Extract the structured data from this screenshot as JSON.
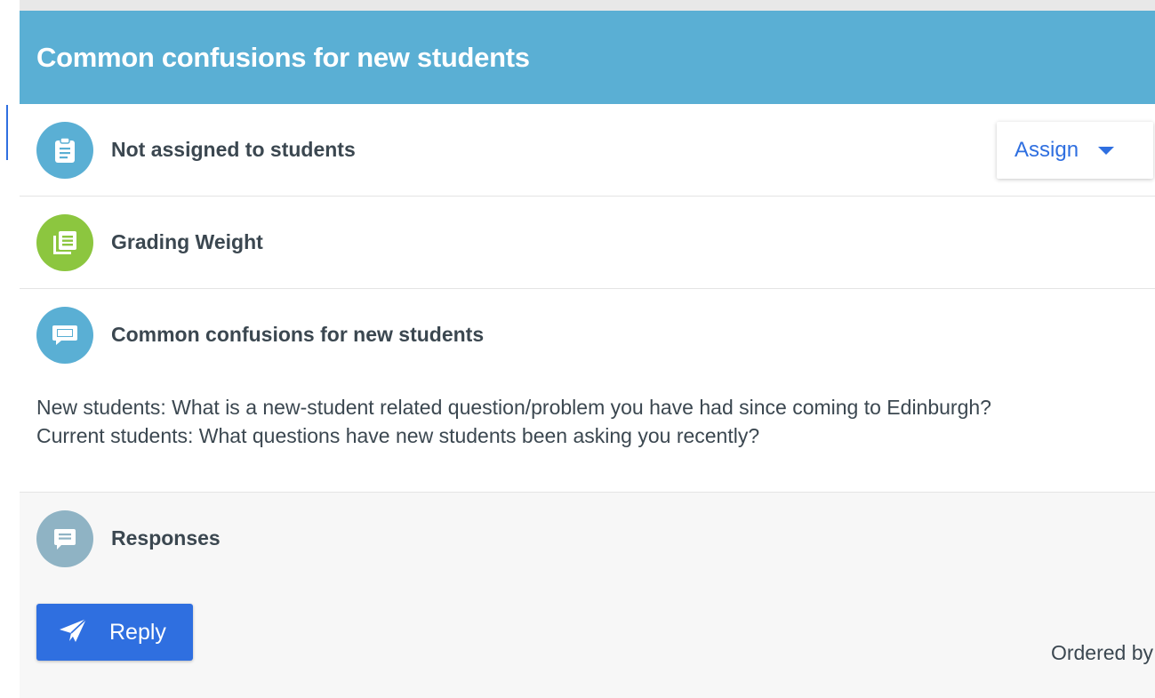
{
  "header": {
    "title": "Common confusions for new students"
  },
  "assignment": {
    "status_label": "Not assigned to students",
    "icon": "clipboard-icon",
    "icon_color": "#5aafd4",
    "assign_label": "Assign"
  },
  "grading": {
    "label": "Grading Weight",
    "icon": "documents-icon",
    "icon_color": "#8cc63f"
  },
  "discussion": {
    "title": "Common confusions for new students",
    "icon": "chat-icon",
    "icon_color": "#5aafd4",
    "prompt_lines": [
      "New students: What is a new-student related question/problem you have had since coming to Edinburgh?",
      "Current students: What questions have new students been asking you recently?"
    ]
  },
  "responses": {
    "label": "Responses",
    "icon": "message-icon",
    "icon_color": "#8fb3c4",
    "reply_label": "Reply",
    "ordered_by_label": "Ordered by"
  },
  "colors": {
    "header_bg": "#5aafd4",
    "accent": "#2f6fe0",
    "text": "#3b4750"
  }
}
